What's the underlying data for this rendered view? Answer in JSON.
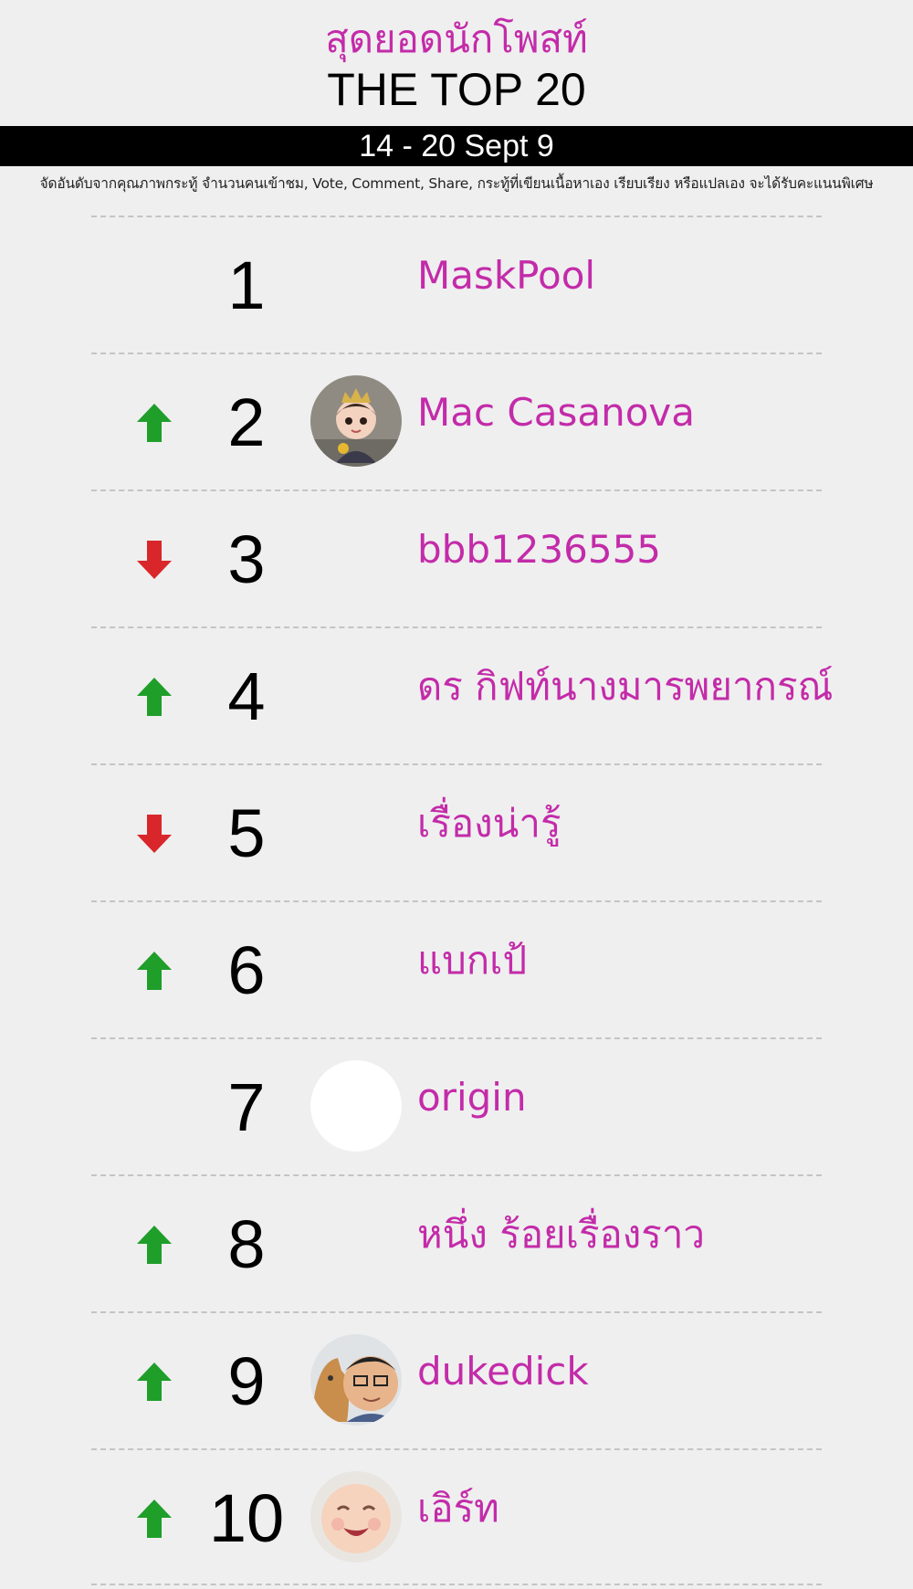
{
  "header": {
    "title_th": "สุดยอดนักโพสท์",
    "title_en": "THE TOP 20",
    "date_range": "14 - 20 Sept 9",
    "note": "จัดอันดับจากคุณภาพกระทู้ จำนวนคนเข้าชม, Vote, Comment, Share, กระทู้ที่เขียนเนื้อหาเอง เรียบเรียง หรือแปลเอง จะได้รับคะแนนพิเศษ"
  },
  "colors": {
    "name": "#c32ba9",
    "up": "#1f9e2a",
    "down": "#d9262b",
    "bar": "#000000"
  },
  "rows": [
    {
      "rank": "1",
      "trend": "none",
      "name": "MaskPool",
      "avatar": "none"
    },
    {
      "rank": "2",
      "trend": "up",
      "name": "Mac Casanova",
      "avatar": "doll"
    },
    {
      "rank": "3",
      "trend": "down",
      "name": "bbb1236555",
      "avatar": "none"
    },
    {
      "rank": "4",
      "trend": "up",
      "name": "ดร กิฟท์นางมารพยากรณ์",
      "avatar": "none"
    },
    {
      "rank": "5",
      "trend": "down",
      "name": "เรื่องน่ารู้",
      "avatar": "none"
    },
    {
      "rank": "6",
      "trend": "up",
      "name": "แบกเป้",
      "avatar": "none"
    },
    {
      "rank": "7",
      "trend": "none",
      "name": "origin",
      "avatar": "blank"
    },
    {
      "rank": "8",
      "trend": "up",
      "name": "หนึ่ง ร้อยเรื่องราว",
      "avatar": "none"
    },
    {
      "rank": "9",
      "trend": "up",
      "name": "dukedick",
      "avatar": "person-cat"
    },
    {
      "rank": "10",
      "trend": "up",
      "name": "เอิร์ท",
      "avatar": "baby"
    }
  ]
}
